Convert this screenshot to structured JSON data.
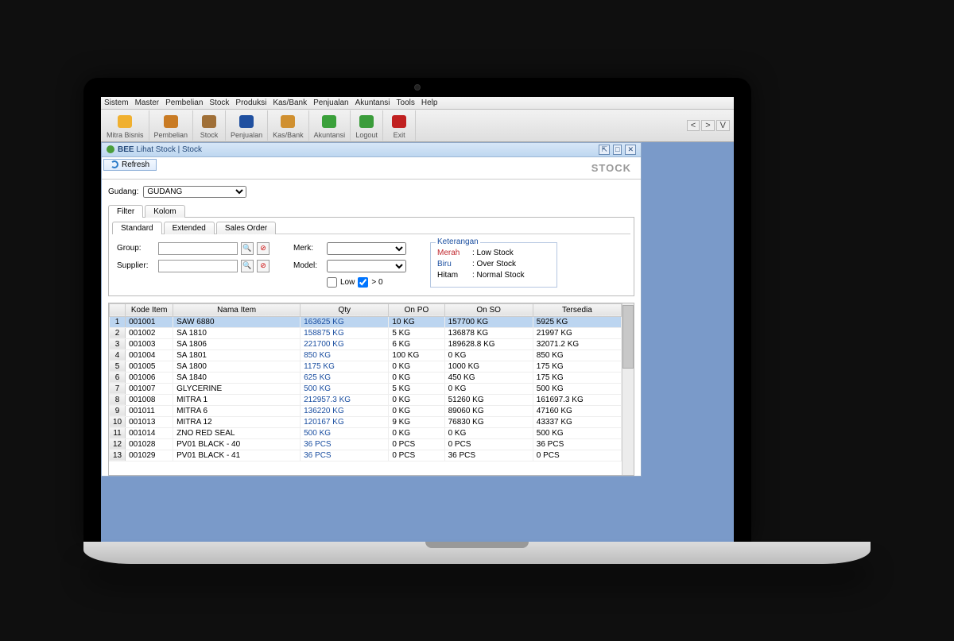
{
  "menu": [
    "Sistem",
    "Master",
    "Pembelian",
    "Stock",
    "Produksi",
    "Kas/Bank",
    "Penjualan",
    "Akuntansi",
    "Tools",
    "Help"
  ],
  "toolbar": [
    {
      "label": "Mitra Bisnis"
    },
    {
      "label": "Pembelian"
    },
    {
      "label": "Stock"
    },
    {
      "label": "Penjualan"
    },
    {
      "label": "Kas/Bank"
    },
    {
      "label": "Akuntansi"
    },
    {
      "label": "Logout"
    },
    {
      "label": "Exit"
    }
  ],
  "window": {
    "title": "Lihat Stock | Stock",
    "brand": "BEE"
  },
  "refresh_label": "Refresh",
  "stock_label": "STOCK",
  "gudang": {
    "label": "Gudang:",
    "value": "GUDANG"
  },
  "tabs1": [
    "Filter",
    "Kolom"
  ],
  "tabs2": [
    "Standard",
    "Extended",
    "Sales Order"
  ],
  "filters": {
    "group": {
      "label": "Group:"
    },
    "supplier": {
      "label": "Supplier:"
    },
    "merk": {
      "label": "Merk:"
    },
    "model": {
      "label": "Model:"
    },
    "low": {
      "label": "Low",
      "gt": "> 0",
      "checked": true
    }
  },
  "legend": {
    "title": "Keterangan",
    "rows": [
      {
        "name": "Merah",
        "desc": ": Low Stock",
        "cls": "red"
      },
      {
        "name": "Biru",
        "desc": ": Over Stock",
        "cls": "blue"
      },
      {
        "name": "Hitam",
        "desc": ": Normal Stock",
        "cls": ""
      }
    ]
  },
  "columns": [
    "",
    "Kode Item",
    "Nama Item",
    "Qty",
    "On PO",
    "On SO",
    "Tersedia"
  ],
  "rows": [
    {
      "n": "1",
      "kode": "001001",
      "nama": "SAW 6880",
      "qty": "163625 KG",
      "po": "10 KG",
      "so": "157700 KG",
      "ts": "5925 KG",
      "selected": true,
      "qtyblue": true
    },
    {
      "n": "2",
      "kode": "001002",
      "nama": "SA 1810",
      "qty": "158875 KG",
      "po": "5 KG",
      "so": "136878 KG",
      "ts": "21997 KG",
      "qtyblue": true
    },
    {
      "n": "3",
      "kode": "001003",
      "nama": "SA 1806",
      "qty": "221700 KG",
      "po": "6 KG",
      "so": "189628.8 KG",
      "ts": "32071.2 KG",
      "qtyblue": true
    },
    {
      "n": "4",
      "kode": "001004",
      "nama": "SA 1801",
      "qty": "850 KG",
      "po": "100 KG",
      "so": "0 KG",
      "ts": "850 KG",
      "qtyblue": true
    },
    {
      "n": "5",
      "kode": "001005",
      "nama": "SA 1800",
      "qty": "1175 KG",
      "po": "0 KG",
      "so": "1000 KG",
      "ts": "175 KG",
      "qtyblue": true
    },
    {
      "n": "6",
      "kode": "001006",
      "nama": "SA 1840",
      "qty": "625 KG",
      "po": "0 KG",
      "so": "450 KG",
      "ts": "175 KG",
      "qtyblue": true
    },
    {
      "n": "7",
      "kode": "001007",
      "nama": "GLYCERINE",
      "qty": "500 KG",
      "po": "5 KG",
      "so": "0 KG",
      "ts": "500 KG",
      "qtyblue": true
    },
    {
      "n": "8",
      "kode": "001008",
      "nama": "MITRA 1",
      "qty": "212957.3 KG",
      "po": "0 KG",
      "so": "51260 KG",
      "ts": "161697.3 KG",
      "qtyblue": true
    },
    {
      "n": "9",
      "kode": "001011",
      "nama": "MITRA 6",
      "qty": "136220 KG",
      "po": "0 KG",
      "so": "89060 KG",
      "ts": "47160 KG",
      "qtyblue": true
    },
    {
      "n": "10",
      "kode": "001013",
      "nama": "MITRA 12",
      "qty": "120167 KG",
      "po": "9 KG",
      "so": "76830 KG",
      "ts": "43337 KG",
      "qtyblue": true
    },
    {
      "n": "11",
      "kode": "001014",
      "nama": "ZNO RED SEAL",
      "qty": "500 KG",
      "po": "0 KG",
      "so": "0 KG",
      "ts": "500 KG",
      "qtyblue": true
    },
    {
      "n": "12",
      "kode": "001028",
      "nama": "PV01 BLACK - 40",
      "qty": "36 PCS",
      "po": "0 PCS",
      "so": "0 PCS",
      "ts": "36 PCS",
      "qtyblue": true
    },
    {
      "n": "13",
      "kode": "001029",
      "nama": "PV01 BLACK - 41",
      "qty": "36 PCS",
      "po": "0 PCS",
      "so": "36 PCS",
      "ts": "0 PCS",
      "qtyblue": true
    }
  ]
}
